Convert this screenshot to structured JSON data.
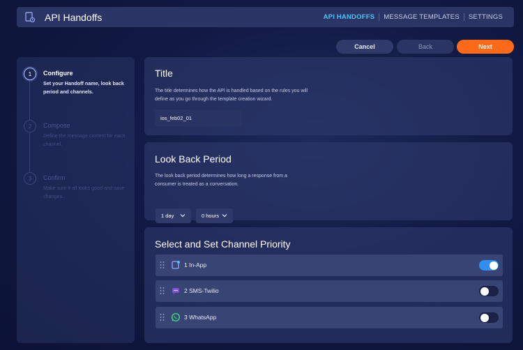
{
  "header": {
    "title": "API Handoffs",
    "tabs": [
      {
        "label": "API HANDOFFS",
        "active": true
      },
      {
        "label": "MESSAGE TEMPLATES",
        "active": false
      },
      {
        "label": "SETTINGS",
        "active": false
      }
    ]
  },
  "actions": {
    "cancel_label": "Cancel",
    "back_label": "Back",
    "next_label": "Next"
  },
  "steps": [
    {
      "number": "1",
      "title": "Configure",
      "description": "Set your Handoff name, look back period and channels.",
      "state": "active"
    },
    {
      "number": "2",
      "title": "Compose",
      "description": "Define the message content for each channel.",
      "state": "inactive"
    },
    {
      "number": "3",
      "title": "Confirm",
      "description": "Make sure it all looks good and save changes.",
      "state": "inactive"
    }
  ],
  "title_section": {
    "heading": "Title",
    "description": "The title determines how the API is handled based on the rules you will define as you go through the template creation wizard.",
    "input_value": "ios_feb02_01"
  },
  "lookback_section": {
    "heading": "Look Back Period",
    "description": "The look back period determines how long a response from a consumer is treated as a conversation.",
    "days_value": "1 day",
    "hours_value": "0 hours"
  },
  "channels_section": {
    "heading": "Select and Set Channel Priority",
    "channels": [
      {
        "label": "1 In-App",
        "icon": "in-app-icon",
        "enabled": true
      },
      {
        "label": "2 SMS-Twilio",
        "icon": "sms-icon",
        "enabled": false
      },
      {
        "label": "3 WhatsApp",
        "icon": "whatsapp-icon",
        "enabled": false
      }
    ]
  },
  "colors": {
    "accent": "#4ec3f7",
    "primary_button": "#ff6a1a",
    "toggle_on": "#2f8ef0"
  }
}
